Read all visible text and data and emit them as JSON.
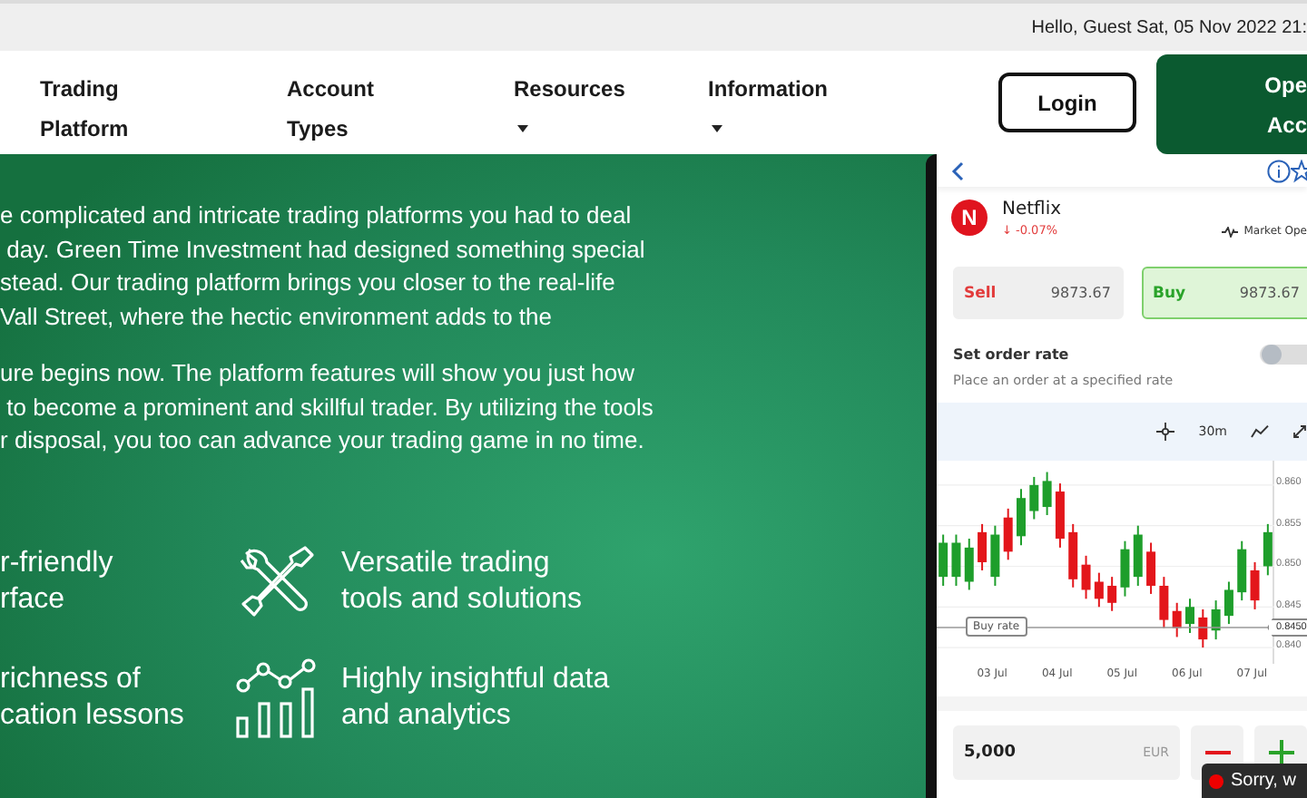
{
  "top_bar": {
    "greeting": "Hello, Guest Sat, 05 Nov 2022 21:"
  },
  "nav": {
    "items": [
      {
        "label": "Trading\nPlatform",
        "dropdown": false
      },
      {
        "label": "Account\nTypes",
        "dropdown": false
      },
      {
        "label": "Resources",
        "dropdown": true
      },
      {
        "label": "Information",
        "dropdown": true
      }
    ],
    "login": "Login",
    "open_account": "Ope\nAcc"
  },
  "intro": {
    "paragraphs": [
      "e complicated and intricate trading platforms you had to deal\n day. Green Time Investment had designed something special\nstead. Our trading platform brings you closer to the real-life\nVall Street, where the hectic environment adds to the",
      "ure begins now. The platform features will show you just how\n to become a prominent and skillful trader. By utilizing the tools\nr disposal, you too can advance your trading game in no time."
    ]
  },
  "features": [
    {
      "kind": "cut",
      "text": "r-friendly\nrface"
    },
    {
      "kind": "tools",
      "text": "Versatile trading\ntools and solutions"
    },
    {
      "kind": "cut",
      "text": "richness of\ncation lessons"
    },
    {
      "kind": "analytics",
      "text": "Highly insightful data\nand analytics"
    }
  ],
  "phone": {
    "instrument": {
      "logo_letter": "N",
      "name": "Netflix",
      "change": "↓ -0.07%",
      "market_status": "Market Ope"
    },
    "sell": {
      "label": "Sell",
      "price": "9873.67"
    },
    "buy": {
      "label": "Buy",
      "price": "9873.67",
      "selected": true
    },
    "order_rate": {
      "title": "Set order rate",
      "hint": "Place an order at a specified rate",
      "on": false
    },
    "chart_toolbar": {
      "interval": "30m"
    },
    "chart": {
      "chart_data": {
        "type": "candlestick",
        "categories": [
          null,
          null,
          null,
          null,
          "03 Jul",
          null,
          null,
          null,
          null,
          "04 Jul",
          null,
          null,
          null,
          null,
          "05 Jul",
          null,
          null,
          null,
          null,
          "06 Jul",
          null,
          null,
          null,
          null,
          "07 Jul",
          null
        ],
        "ohlc": [
          [
            0.8487,
            0.8539,
            0.8476,
            0.8529
          ],
          [
            0.8487,
            0.8539,
            0.8476,
            0.8529
          ],
          [
            0.8481,
            0.8534,
            0.8471,
            0.8523
          ],
          [
            0.8542,
            0.8552,
            0.8495,
            0.8505
          ],
          [
            0.8487,
            0.855,
            0.8476,
            0.8539
          ],
          [
            0.856,
            0.8571,
            0.8508,
            0.8518
          ],
          [
            0.8537,
            0.8595,
            0.8526,
            0.8584
          ],
          [
            0.8568,
            0.861,
            0.8558,
            0.86
          ],
          [
            0.8573,
            0.8616,
            0.8563,
            0.8605
          ],
          [
            0.8592,
            0.8602,
            0.8523,
            0.8534
          ],
          [
            0.8542,
            0.8552,
            0.8474,
            0.8484
          ],
          [
            0.8502,
            0.8513,
            0.846,
            0.8471
          ],
          [
            0.8481,
            0.8492,
            0.845,
            0.846
          ],
          [
            0.8476,
            0.8487,
            0.8445,
            0.8455
          ],
          [
            0.8474,
            0.8531,
            0.8463,
            0.8521
          ],
          [
            0.8487,
            0.855,
            0.8476,
            0.8539
          ],
          [
            0.8518,
            0.8529,
            0.8466,
            0.8476
          ],
          [
            0.8476,
            0.8487,
            0.8424,
            0.8434
          ],
          [
            0.8445,
            0.8455,
            0.8413,
            0.8424
          ],
          [
            0.8429,
            0.846,
            0.8418,
            0.845
          ],
          [
            0.8437,
            0.8447,
            0.84,
            0.841
          ],
          [
            0.8421,
            0.8458,
            0.841,
            0.8447
          ],
          [
            0.8439,
            0.8481,
            0.8429,
            0.8471
          ],
          [
            0.8468,
            0.8531,
            0.8458,
            0.8521
          ],
          [
            0.8495,
            0.8505,
            0.8447,
            0.8458
          ],
          [
            0.85,
            0.8552,
            0.8489,
            0.8542
          ]
        ],
        "grid": true,
        "ylim": [
          0.838,
          0.863
        ],
        "yticks": [
          {
            "value": 0.86,
            "label": "0.860"
          },
          {
            "value": 0.855,
            "label": "0.855"
          },
          {
            "value": 0.85,
            "label": "0.850"
          },
          {
            "value": 0.845,
            "label": "0.845"
          },
          {
            "value": 0.84,
            "label": "0.840"
          }
        ]
      },
      "rate_line": {
        "label": "Buy rate",
        "tag": "0.8450"
      }
    },
    "amount": {
      "value": "5,000",
      "currency": "EUR"
    }
  },
  "toast": {
    "text": "Sorry, w"
  }
}
